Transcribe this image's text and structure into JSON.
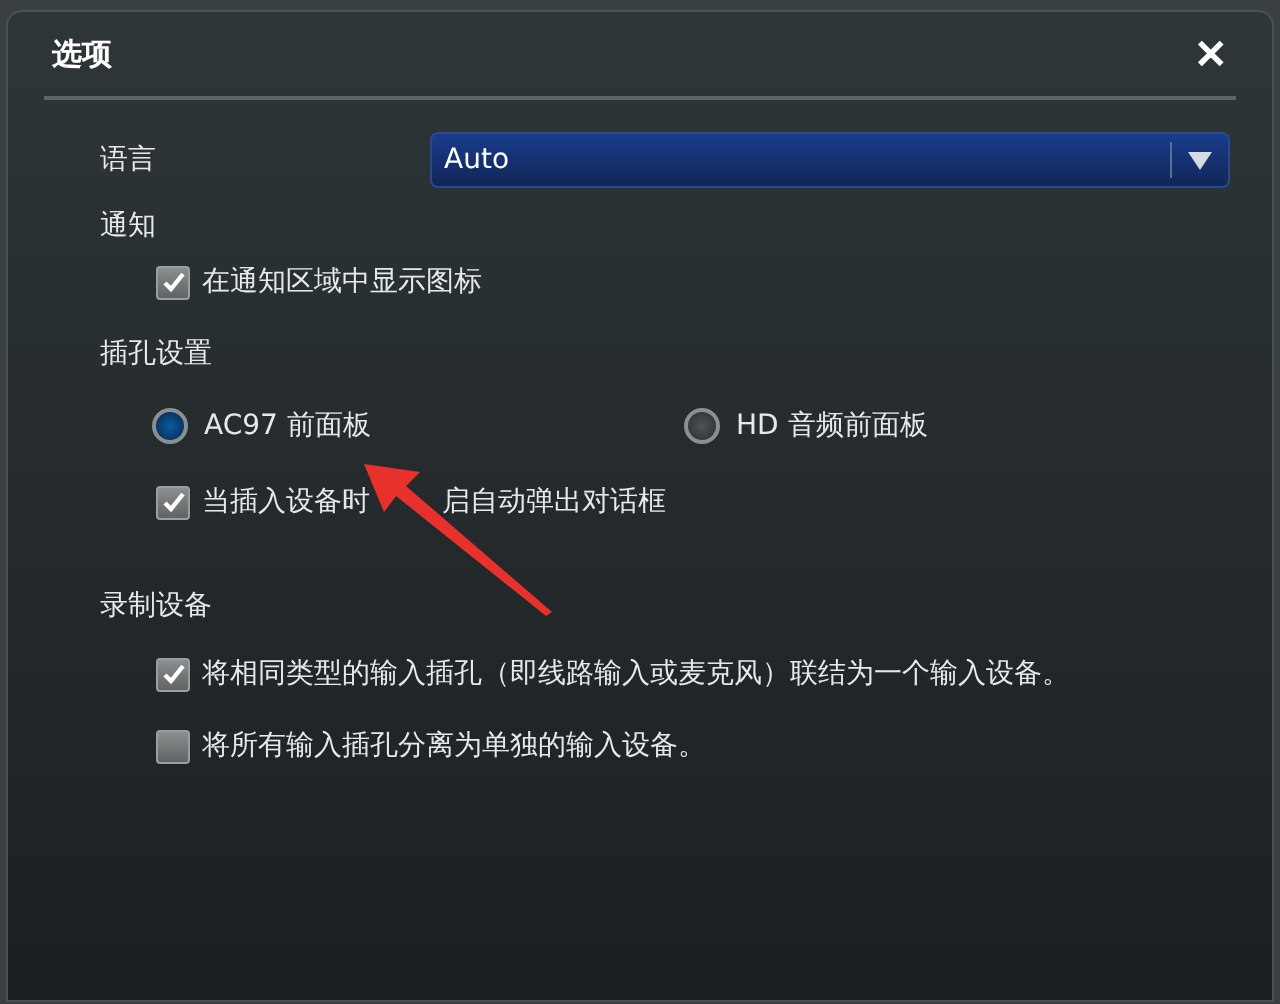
{
  "window": {
    "title": "选项",
    "close": "✕"
  },
  "language": {
    "label": "语言",
    "value": "Auto"
  },
  "notification": {
    "heading": "通知",
    "options": [
      {
        "label": "在通知区域中显示图标",
        "checked": true
      }
    ]
  },
  "jack": {
    "heading": "插孔设置",
    "radios": [
      {
        "label": "AC97 前面板",
        "selected": true
      },
      {
        "label": "HD 音频前面板",
        "selected": false
      }
    ],
    "options": [
      {
        "label": "当插入设备时",
        "label_after_arrow": "启自动弹出对话框",
        "checked": true
      }
    ]
  },
  "recording": {
    "heading": "录制设备",
    "options": [
      {
        "label": "将相同类型的输入插孔（即线路输入或麦克风）联结为一个输入设备。",
        "checked": true
      },
      {
        "label": "将所有输入插孔分离为单独的输入设备。",
        "checked": false
      }
    ]
  },
  "annotation": {
    "kind": "arrow",
    "color": "#e8302c"
  }
}
